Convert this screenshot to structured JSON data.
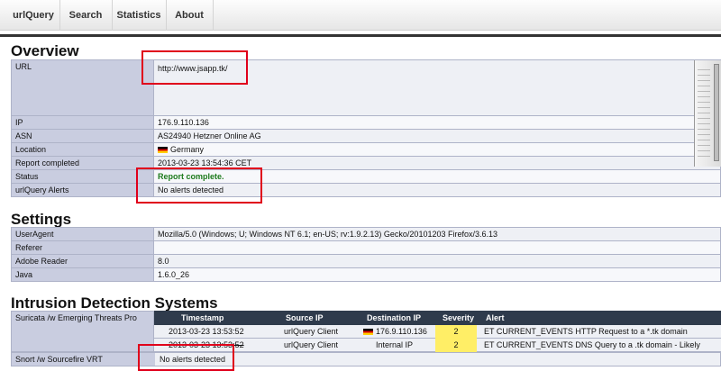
{
  "navbar": {
    "items": [
      "urlQuery",
      "Search",
      "Statistics",
      "About"
    ]
  },
  "overview": {
    "title": "Overview",
    "rows": [
      {
        "key": "URL",
        "value": "http://www.jsapp.tk/"
      },
      {
        "key": "IP",
        "value": "176.9.110.136"
      },
      {
        "key": "ASN",
        "value": "AS24940 Hetzner Online AG"
      },
      {
        "key": "Location",
        "value": "Germany"
      },
      {
        "key": "Report completed",
        "value": "2013-03-23 13:54:36 CET"
      },
      {
        "key": "Status",
        "value": "Report complete."
      },
      {
        "key": "urlQuery Alerts",
        "value": "No alerts detected"
      }
    ]
  },
  "settings": {
    "title": "Settings",
    "rows": [
      {
        "key": "UserAgent",
        "value": "Mozilla/5.0 (Windows; U; Windows NT 6.1; en-US; rv:1.9.2.13) Gecko/20101203 Firefox/3.6.13"
      },
      {
        "key": "Referer",
        "value": ""
      },
      {
        "key": "Adobe Reader",
        "value": "8.0"
      },
      {
        "key": "Java",
        "value": "1.6.0_26"
      }
    ]
  },
  "ids": {
    "title": "Intrusion Detection Systems",
    "suricata_label": "Suricata /w Emerging Threats Pro",
    "columns": [
      "Timestamp",
      "Source IP",
      "Destination IP",
      "Severity",
      "Alert"
    ],
    "rows": [
      {
        "timestamp": "2013-03-23 13:53:52",
        "source": "urlQuery Client",
        "dest": "176.9.110.136",
        "severity": "2",
        "alert": "ET CURRENT_EVENTS HTTP Request to a *.tk domain"
      },
      {
        "timestamp": "2013-03-23 13:53:52",
        "source": "urlQuery Client",
        "dest": "Internal IP",
        "severity": "2",
        "alert": "ET CURRENT_EVENTS DNS Query to a .tk domain - Likely Hostile"
      }
    ],
    "snort_label": "Snort /w Sourcefire VRT",
    "snort_value": "No alerts detected"
  },
  "colors": {
    "annotation_box": "#e0001b",
    "status_green": "#1c7a1c",
    "severity_highlight": "#ffee66",
    "table_header": "#2f3b4c"
  }
}
